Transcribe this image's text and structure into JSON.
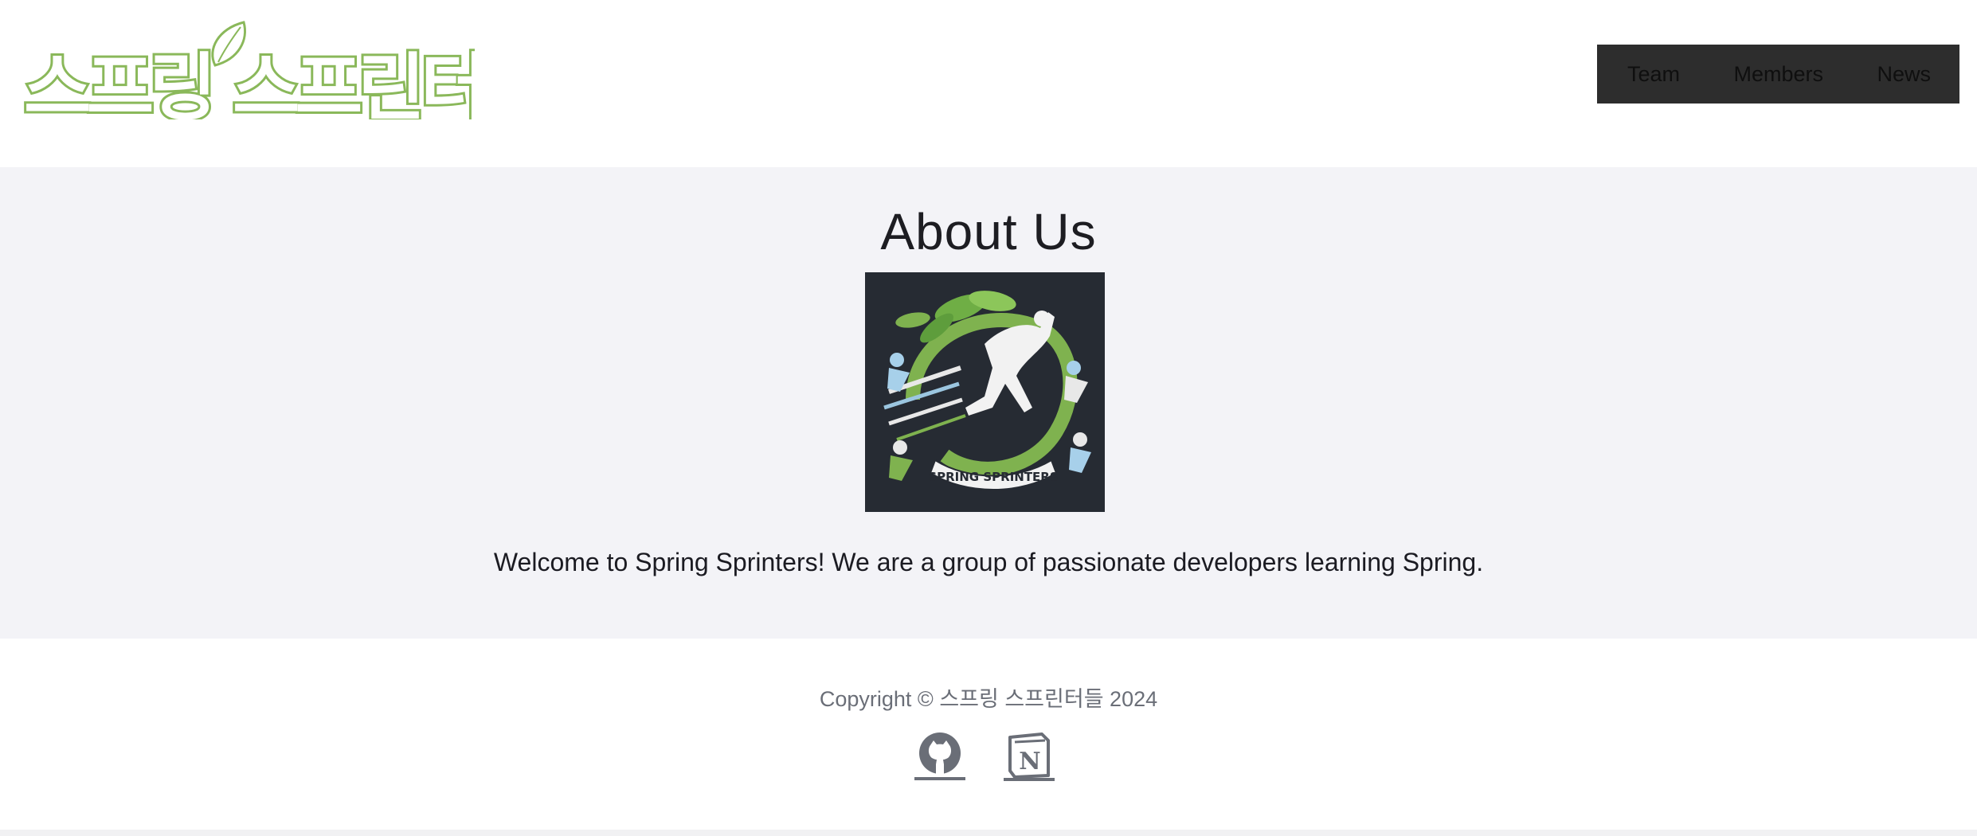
{
  "header": {
    "logo_text": "스프링 스프린터들",
    "nav": {
      "items": [
        "Team",
        "Members",
        "News"
      ]
    }
  },
  "main": {
    "title": "About Us",
    "emblem_text": "SPRING SPRINTERS",
    "welcome": "Welcome to Spring Sprinters! We are a group of passionate developers learning Spring."
  },
  "footer": {
    "copyright": "Copyright © 스프링 스프린터들 2024",
    "links": [
      "github-icon",
      "notion-icon"
    ]
  },
  "colors": {
    "logo_green": "#8ab85a",
    "nav_bg": "#2d2d2d",
    "main_bg": "#f3f3f7",
    "emblem_bg": "#262b33",
    "footer_text": "#6a6e77"
  }
}
